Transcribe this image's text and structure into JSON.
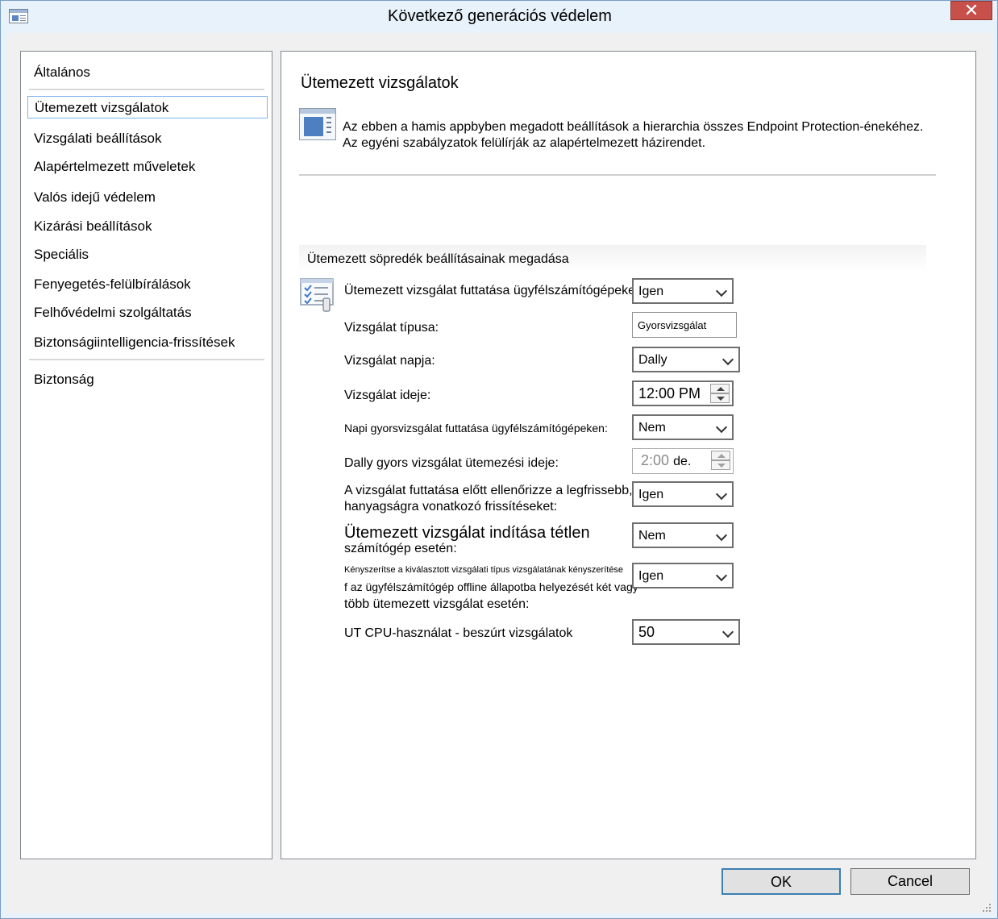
{
  "window": {
    "title": "Következő generációs védelem",
    "close_label": "✕"
  },
  "nav": {
    "items": [
      {
        "label": "Általános"
      },
      {
        "label": "Ütemezett vizsgálatok"
      },
      {
        "label": "Vizsgálati beállítások"
      },
      {
        "label": "Alapértelmezett műveletek"
      },
      {
        "label": "Valós idejű védelem"
      },
      {
        "label": "Kizárási beállítások"
      },
      {
        "label": "Speciális"
      },
      {
        "label": "Fenyegetés-felülbírálások"
      },
      {
        "label": "Felhővédelmi szolgáltatás"
      },
      {
        "label": "Biztonságiintelligencia-frissítések"
      },
      {
        "label": "Biztonság"
      }
    ],
    "selected": "Ütemezett vizsgálatok"
  },
  "content": {
    "title": "Ütemezett vizsgálatok",
    "info_line1": "Az ebben a hamis appbyben megadott beállítások a hierarchia összes Endpoint Protection-énekéhez.",
    "info_line2": "Az egyéni szabályzatok felülírják az alapértelmezett házirendet.",
    "group_header": "Ütemezett söpredék beállításainak megadása"
  },
  "settings": {
    "run_scheduled": {
      "label": "Ütemezett vizsgálat futtatása ügyfélszámítógépeken:",
      "value": "Igen"
    },
    "scan_type": {
      "label": "Vizsgálat típusa:",
      "value": "Gyorsvizsgálat"
    },
    "scan_day": {
      "label": "Vizsgálat napja:",
      "value": "Dally"
    },
    "scan_time": {
      "label": "Vizsgálat ideje:",
      "value": "12:00 PM"
    },
    "daily_quick": {
      "label": "Napi gyorsvizsgálat futtatása ügyfélszámítógépeken:",
      "value": "Nem"
    },
    "daily_quick_time": {
      "label": "Dally gyors vizsgálat ütemezési ideje:",
      "value": "2:00",
      "suffix": "de."
    },
    "check_updates": {
      "label_line1": "A vizsgálat futtatása előtt ellenőrizze a legfrissebb,",
      "label_line2": "hanyagságra vonatkozó frissítéseket:",
      "value": "Igen"
    },
    "idle_start": {
      "label_line1": "Ütemezett vizsgálat indítása tétlen",
      "label_line2": "számítógép esetén:",
      "value": "Nem"
    },
    "force_scan": {
      "label_line1": "Kényszerítse a kiválasztott vizsgálati típus vizsgálatának kényszerítése",
      "label_line2": "f az ügyfélszámítógép offline állapotba helyezését két vagy",
      "label_line3": "több ütemezett vizsgálat esetén:",
      "value": "Igen"
    },
    "cpu_usage": {
      "label": "UT CPU-használat - beszúrt vizsgálatok",
      "value": "50"
    }
  },
  "buttons": {
    "ok": "OK",
    "cancel": "Cancel"
  },
  "colors": {
    "window_bg": "#e8f2fb",
    "close_red": "#c7504a",
    "selection_border": "#7eb4ea",
    "ok_border": "#3c7fb1"
  }
}
